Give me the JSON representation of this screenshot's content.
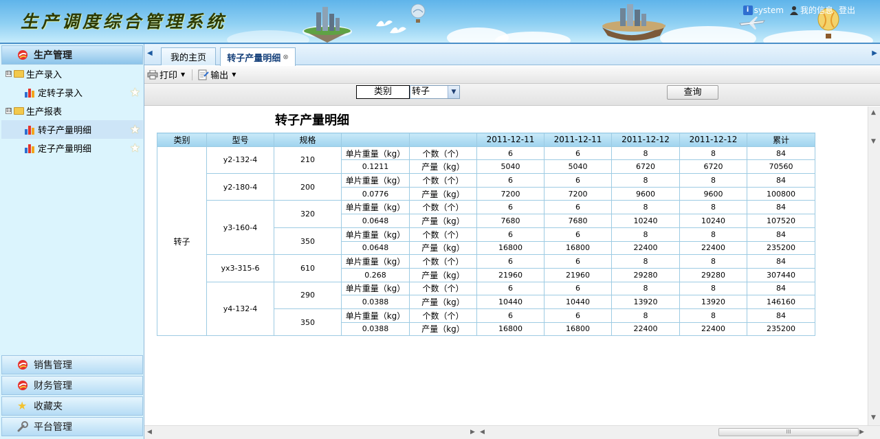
{
  "app": {
    "title": "生产调度综合管理系统"
  },
  "header": {
    "user": "system",
    "my_info": "我的信息",
    "logout": "登出"
  },
  "sidebar": {
    "sections": [
      {
        "label": "生产管理",
        "active": true
      },
      {
        "label": "销售管理"
      },
      {
        "label": "财务管理"
      },
      {
        "label": "收藏夹"
      },
      {
        "label": "平台管理"
      }
    ],
    "tree": [
      {
        "label": "生产录入",
        "type": "folder",
        "toggle": "⊟"
      },
      {
        "label": "定转子录入",
        "type": "leaf"
      },
      {
        "label": "生产报表",
        "type": "folder",
        "toggle": "⊟"
      },
      {
        "label": "转子产量明细",
        "type": "leaf",
        "selected": true
      },
      {
        "label": "定子产量明细",
        "type": "leaf"
      }
    ]
  },
  "tabs": [
    {
      "label": "我的主页"
    },
    {
      "label": "转子产量明细",
      "active": true,
      "close": "⊗"
    }
  ],
  "toolbar": {
    "print": "打印",
    "export": "输出"
  },
  "filter": {
    "label": "类别",
    "value": "转子",
    "query": "查询"
  },
  "report": {
    "title": "转子产量明细",
    "headers": [
      "类别",
      "型号",
      "规格",
      "",
      "",
      "2011-12-11",
      "2011-12-11",
      "2011-12-12",
      "2011-12-12",
      "累计"
    ],
    "category": "转子",
    "weight_label": "单片重量（kg）",
    "count_label": "个数（个）",
    "output_label": "产量（kg）",
    "groups": [
      {
        "model": "y2-132-4",
        "specs": [
          {
            "spec": "210",
            "weight": "0.1211",
            "counts": [
              "6",
              "6",
              "8",
              "8",
              "84"
            ],
            "outputs": [
              "5040",
              "5040",
              "6720",
              "6720",
              "70560"
            ]
          }
        ]
      },
      {
        "model": "y2-180-4",
        "specs": [
          {
            "spec": "200",
            "weight": "0.0776",
            "counts": [
              "6",
              "6",
              "8",
              "8",
              "84"
            ],
            "outputs": [
              "7200",
              "7200",
              "9600",
              "9600",
              "100800"
            ]
          }
        ]
      },
      {
        "model": "y3-160-4",
        "specs": [
          {
            "spec": "320",
            "weight": "0.0648",
            "counts": [
              "6",
              "6",
              "8",
              "8",
              "84"
            ],
            "outputs": [
              "7680",
              "7680",
              "10240",
              "10240",
              "107520"
            ]
          },
          {
            "spec": "350",
            "weight": "0.0648",
            "counts": [
              "6",
              "6",
              "8",
              "8",
              "84"
            ],
            "outputs": [
              "16800",
              "16800",
              "22400",
              "22400",
              "235200"
            ]
          }
        ]
      },
      {
        "model": "yx3-315-6",
        "specs": [
          {
            "spec": "610",
            "weight": "0.268",
            "counts": [
              "6",
              "6",
              "8",
              "8",
              "84"
            ],
            "outputs": [
              "21960",
              "21960",
              "29280",
              "29280",
              "307440"
            ]
          }
        ]
      },
      {
        "model": "y4-132-4",
        "specs": [
          {
            "spec": "290",
            "weight": "0.0388",
            "counts": [
              "6",
              "6",
              "8",
              "8",
              "84"
            ],
            "outputs": [
              "10440",
              "10440",
              "13920",
              "13920",
              "146160"
            ]
          },
          {
            "spec": "350",
            "weight": "0.0388",
            "counts": [
              "6",
              "6",
              "8",
              "8",
              "84"
            ],
            "outputs": [
              "16800",
              "16800",
              "22400",
              "22400",
              "235200"
            ]
          }
        ]
      }
    ]
  },
  "icons": {
    "info": "info-icon",
    "user": "user-icon",
    "printer": "printer-icon",
    "export": "export-icon",
    "star": "star-icon",
    "folder": "folder-icon",
    "chart": "bar-chart-icon"
  },
  "colors": {
    "banner": "#5fb4ea",
    "sidebar_bg": "#dbf4fd",
    "table_header": "#9fd3ee",
    "table_border": "#9dcbe3"
  }
}
